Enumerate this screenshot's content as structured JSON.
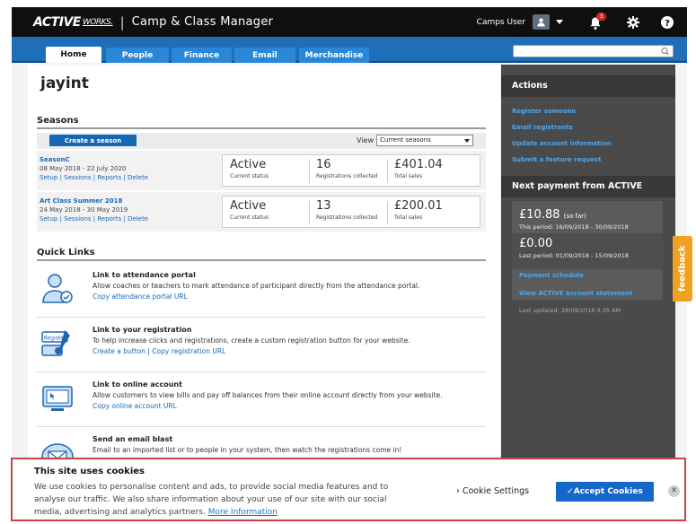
{
  "header": {
    "logo_active": "ACTIVE",
    "logo_works": "WORKS.",
    "separator": "|",
    "app_title": "Camp & Class Manager",
    "user_label": "Camps User",
    "notification_count": "3"
  },
  "nav": {
    "tabs": [
      {
        "label": "Home",
        "active": true
      },
      {
        "label": "People",
        "active": false
      },
      {
        "label": "Finance",
        "active": false
      },
      {
        "label": "Email",
        "active": false
      },
      {
        "label": "Merchandise",
        "active": false
      }
    ],
    "search_placeholder": ""
  },
  "main": {
    "title": "jayint",
    "seasons": {
      "heading": "Seasons",
      "create_label": "Create a season",
      "view_label": "View",
      "view_selected": "Current seasons",
      "rows": [
        {
          "name": "SeasonC",
          "dates": "08 May 2018 - 22 July 2020",
          "links": "Setup | Sessions | Reports | Delete",
          "status": "Active",
          "status_label": "Current status",
          "registrations": "16",
          "registrations_label": "Registrations collected",
          "sales": "£401.04",
          "sales_label": "Total sales"
        },
        {
          "name": "Art Class Summer 2018",
          "dates": "24 May 2018 - 30 May 2019",
          "links": "Setup | Sessions | Reports | Delete",
          "status": "Active",
          "status_label": "Current status",
          "registrations": "13",
          "registrations_label": "Registrations collected",
          "sales": "£200.01",
          "sales_label": "Total sales"
        }
      ]
    },
    "quick_links": {
      "heading": "Quick Links",
      "items": [
        {
          "title": "Link to attendance portal",
          "desc": "Allow coaches or teachers to mark attendance of participant directly from the attendance portal.",
          "links": "Copy attendance portal URL"
        },
        {
          "title": "Link to your registration",
          "desc": "To help increase clicks and registrations, create a custom registration button for your website.",
          "links": "Create a button | Copy registration URL"
        },
        {
          "title": "Link to online account",
          "desc": "Allow customers to view bills and pay off balances from their online account directly from your website.",
          "links": "Copy online account URL"
        },
        {
          "title": "Send an email blast",
          "desc": "Email to an imported list or to people in your system, then watch the registrations come in!",
          "links": ""
        }
      ],
      "registration_icon_text": "Register"
    }
  },
  "side": {
    "actions_heading": "Actions",
    "actions": [
      "Register someone",
      "Email registrants",
      "Update account information",
      "Submit a feature request"
    ],
    "payment_heading": "Next payment from ACTIVE",
    "current_amount": "£10.88",
    "current_note": "(so far)",
    "current_period": "This period: 16/09/2018 - 30/09/2018",
    "last_amount": "£0.00",
    "last_period": "Last period: 01/09/2018 - 15/09/2018",
    "payment_schedule": "Payment schedule",
    "view_statement": "View ACTIVE account statement",
    "last_updated": "Last updated: 28/09/2018 9:35 AM"
  },
  "feedback_label": "feedback",
  "cookie": {
    "title": "This site uses cookies",
    "text": "We use cookies to personalise content and ads, to provide social media features and to analyse our traffic. We also share information about your use of our site with our social media, advertising and analytics partners.",
    "more_info": "More Information",
    "settings_label": "Cookie Settings",
    "accept_label": "✓Accept Cookies",
    "close_symbol": "✕"
  },
  "colors": {
    "nav_blue": "#1e6fb8",
    "link_blue": "#1668b4",
    "side_link": "#4aa7f0",
    "feedback_orange": "#f1a020",
    "cookie_border": "#c9424a"
  }
}
